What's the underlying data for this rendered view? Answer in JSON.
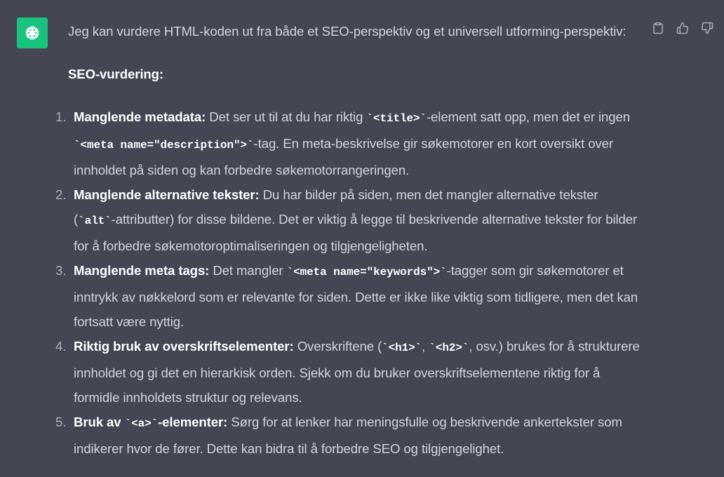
{
  "assistant": {
    "avatar_icon": "openai-logo-icon",
    "avatar_color": "#19c37d",
    "actions": [
      {
        "name": "copy-button",
        "icon": "clipboard-icon"
      },
      {
        "name": "thumbs-up-button",
        "icon": "thumbs-up-icon"
      },
      {
        "name": "thumbs-down-button",
        "icon": "thumbs-down-icon"
      }
    ]
  },
  "message": {
    "intro": "Jeg kan vurdere HTML-koden ut fra både et SEO-perspektiv og et universell utforming-perspektiv:",
    "heading": "SEO-vurdering:",
    "items": [
      {
        "num": "1.",
        "title": "Manglende metadata:",
        "t1": " Det ser ut til at du har riktig ",
        "c1": "`<title>`",
        "t2": "-element satt opp, men det er ingen ",
        "c2": "`<meta name=\"description\">`",
        "t3": "-tag. En meta-beskrivelse gir søkemotorer en kort oversikt over innholdet på siden og kan forbedre søkemotorrangeringen."
      },
      {
        "num": "2.",
        "title": "Manglende alternative tekster:",
        "t1": " Du har bilder på siden, men det mangler alternative tekster (",
        "c1": "`alt`",
        "t2": "-attributter) for disse bildene. Det er viktig å legge til beskrivende alternative tekster for bilder for å forbedre søkemotoroptimaliseringen og tilgjengeligheten."
      },
      {
        "num": "3.",
        "title": "Manglende meta tags:",
        "t1": " Det mangler ",
        "c1": "`<meta name=\"keywords\">`",
        "t2": "-tagger som gir søkemotorer et inntrykk av nøkkelord som er relevante for siden. Dette er ikke like viktig som tidligere, men det kan fortsatt være nyttig."
      },
      {
        "num": "4.",
        "title": "Riktig bruk av overskriftselementer:",
        "t1": " Overskriftene (",
        "c1": "`<h1>`",
        "t2": ", ",
        "c2": "`<h2>`",
        "t3": ", osv.) brukes for å strukturere innholdet og gi det en hierarkisk orden. Sjekk om du bruker overskriftselementene riktig for å formidle innholdets struktur og relevans."
      },
      {
        "num": "5.",
        "title_a": "Bruk av ",
        "title_code": "`<a>`",
        "title_b": "-elementer:",
        "t1": " Sørg for at lenker har meningsfulle og beskrivende ankertekster som indikerer hvor de fører. Dette kan bidra til å forbedre SEO og tilgjengelighet."
      }
    ]
  }
}
